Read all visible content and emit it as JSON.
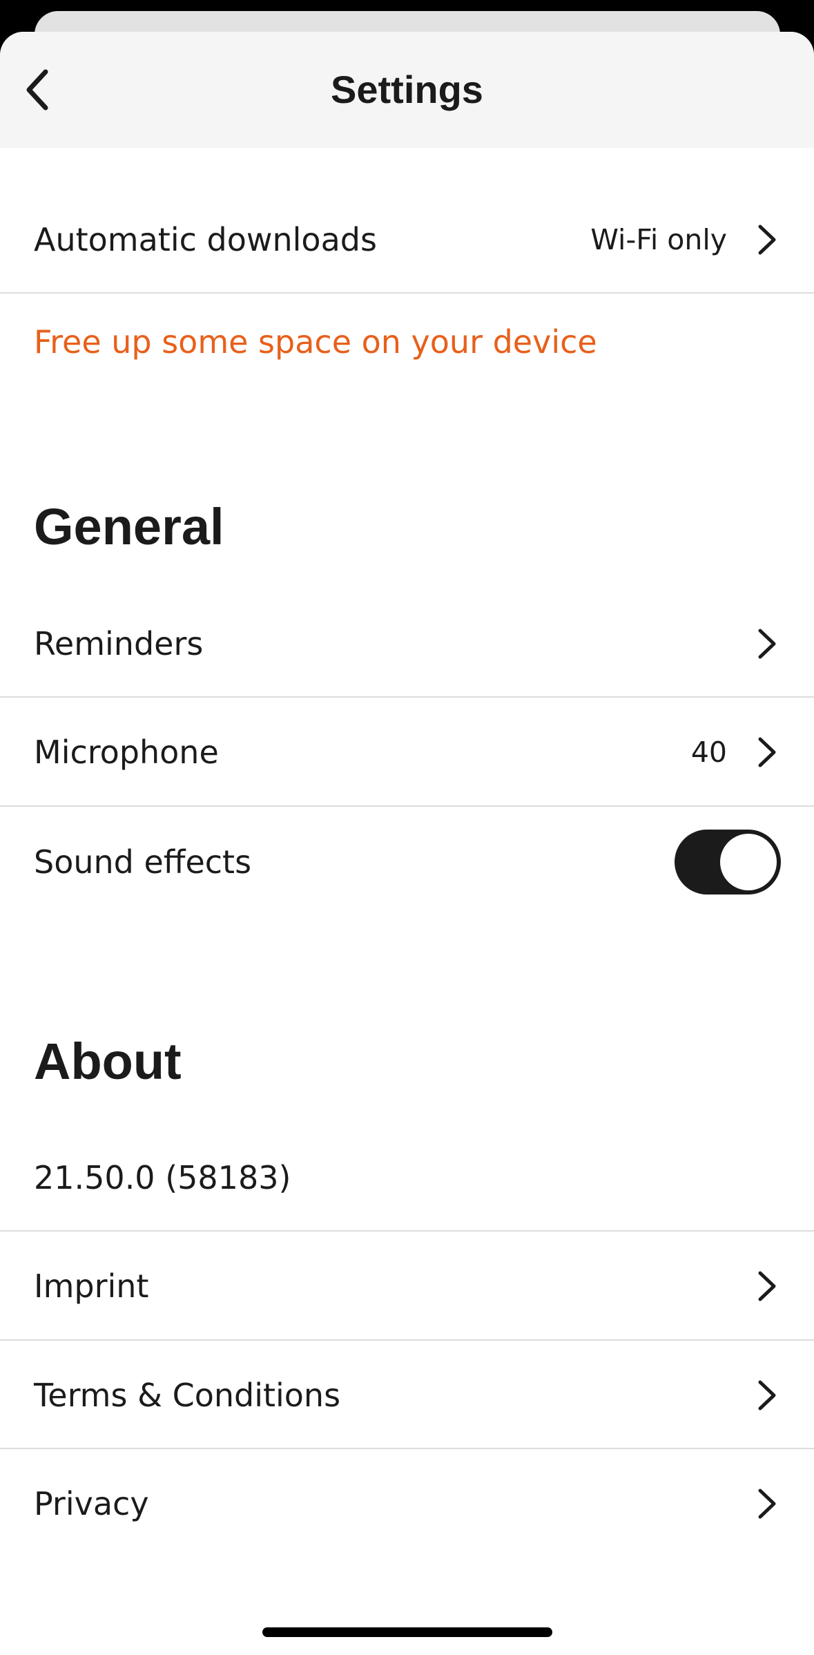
{
  "header": {
    "title": "Settings",
    "back_icon": "chevron-left-icon"
  },
  "downloads": {
    "automatic_label": "Automatic downloads",
    "automatic_value": "Wi-Fi only",
    "free_space_link": "Free up some space on your device"
  },
  "general": {
    "heading": "General",
    "reminders_label": "Reminders",
    "microphone_label": "Microphone",
    "microphone_value": "40",
    "sound_effects_label": "Sound effects",
    "sound_effects_on": true
  },
  "about": {
    "heading": "About",
    "version": "21.50.0 (58183)",
    "imprint_label": "Imprint",
    "terms_label": "Terms & Conditions",
    "privacy_label": "Privacy"
  },
  "colors": {
    "accent_link": "#e8601b",
    "toggle_on": "#1b1b1b",
    "text": "#1b1b1b"
  }
}
